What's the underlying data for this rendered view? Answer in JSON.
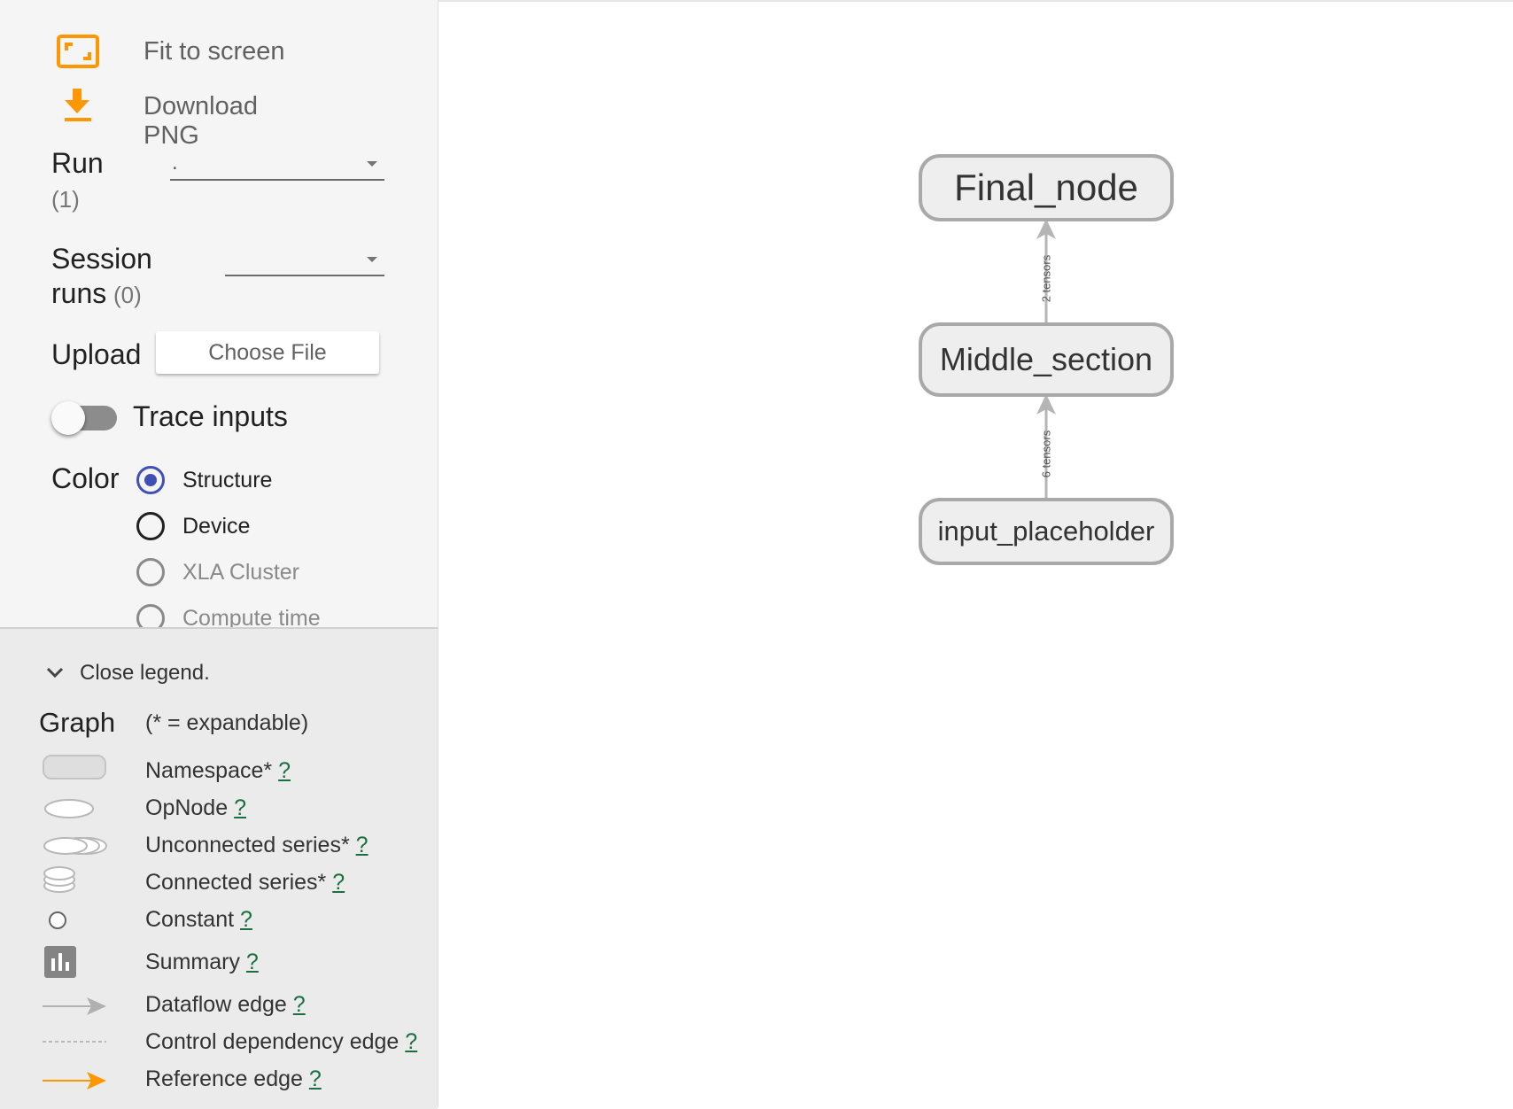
{
  "toolbar": {
    "fit_label": "Fit to screen",
    "download_label": "Download PNG"
  },
  "run": {
    "label": "Run",
    "count": "(1)",
    "value": "."
  },
  "session": {
    "label_line1": "Session",
    "label_line2": "runs",
    "count": "(0)",
    "value": ""
  },
  "upload": {
    "label": "Upload",
    "button": "Choose File"
  },
  "trace": {
    "label": "Trace inputs",
    "on": false
  },
  "color": {
    "label": "Color",
    "options": [
      {
        "label": "Structure",
        "state": "selected"
      },
      {
        "label": "Device",
        "state": "enabled"
      },
      {
        "label": "XLA Cluster",
        "state": "disabled"
      },
      {
        "label": "Compute time",
        "state": "disabled"
      }
    ]
  },
  "legend": {
    "toggle_label": "Close legend.",
    "title": "Graph",
    "subtitle": "(* = expandable)",
    "help_mark": "?",
    "items": [
      {
        "label": "Namespace*",
        "icon": "namespace-icon"
      },
      {
        "label": "OpNode",
        "icon": "opnode-icon"
      },
      {
        "label": "Unconnected series*",
        "icon": "unconnected-series-icon"
      },
      {
        "label": "Connected series*",
        "icon": "connected-series-icon"
      },
      {
        "label": "Constant",
        "icon": "constant-icon"
      },
      {
        "label": "Summary",
        "icon": "summary-icon"
      },
      {
        "label": "Dataflow edge",
        "icon": "dataflow-edge-icon"
      },
      {
        "label": "Control dependency edge",
        "icon": "control-edge-icon"
      },
      {
        "label": "Reference edge",
        "icon": "reference-edge-icon"
      }
    ]
  },
  "graph": {
    "nodes": [
      {
        "name": "Final_node"
      },
      {
        "name": "Middle_section"
      },
      {
        "name": "input_placeholder"
      }
    ],
    "edges": [
      {
        "from": "Middle_section",
        "to": "Final_node",
        "label": "2 tensors"
      },
      {
        "from": "input_placeholder",
        "to": "Middle_section",
        "label": "6 tensors"
      }
    ]
  },
  "colors": {
    "accent_orange": "#ff9800",
    "radio_selected": "#3f51b5",
    "node_border": "#a9a9a9",
    "node_fill": "#eeeeee",
    "edge": "#b5b5b5",
    "help_link": "#1a6e40"
  }
}
